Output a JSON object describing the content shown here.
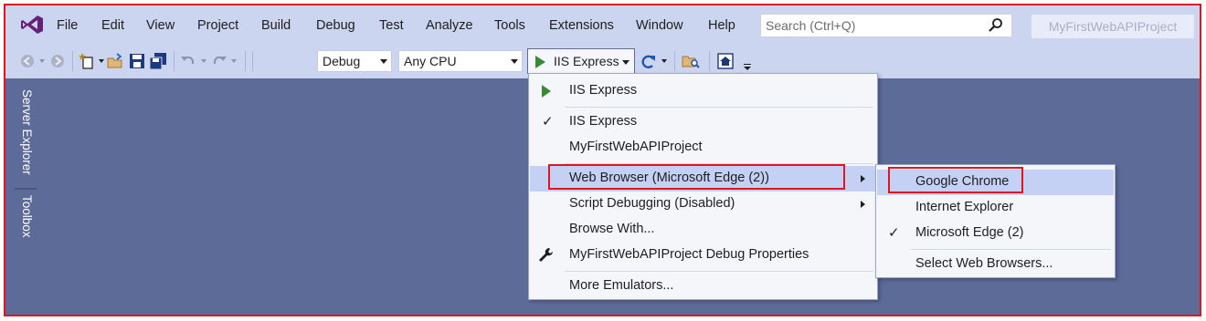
{
  "menubar": {
    "items": [
      "File",
      "Edit",
      "View",
      "Project",
      "Build",
      "Debug",
      "Test",
      "Analyze",
      "Tools",
      "Extensions",
      "Window",
      "Help"
    ],
    "search_placeholder": "Search (Ctrl+Q)",
    "project_name": "MyFirstWebAPIProject"
  },
  "toolbar": {
    "configuration": "Debug",
    "platform": "Any CPU",
    "run_target": "IIS Express",
    "icons": [
      "back-icon",
      "forward-icon",
      "new-project-icon",
      "open-folder-icon",
      "save-icon",
      "save-all-icon",
      "undo-icon",
      "redo-icon",
      "refresh-icon",
      "find-in-files-icon",
      "home-icon"
    ]
  },
  "side_tabs": {
    "server_explorer": "Server Explorer",
    "toolbox": "Toolbox"
  },
  "run_menu": {
    "items": [
      {
        "label": "IIS Express",
        "icon": "play-icon"
      },
      {
        "label": "IIS Express",
        "checked": true
      },
      {
        "label": "MyFirstWebAPIProject"
      },
      {
        "label": "Web Browser (Microsoft Edge (2))",
        "submenu": true,
        "highlighted": true
      },
      {
        "label": "Script Debugging (Disabled)",
        "submenu": true
      },
      {
        "label": "Browse With..."
      },
      {
        "label": "MyFirstWebAPIProject Debug Properties",
        "icon": "wrench-icon"
      },
      {
        "label": "More Emulators..."
      }
    ]
  },
  "browser_submenu": {
    "items": [
      {
        "label": "Google Chrome",
        "highlighted": true
      },
      {
        "label": "Internet Explorer"
      },
      {
        "label": "Microsoft Edge (2)",
        "checked": true
      },
      {
        "label": "Select Web Browsers..."
      }
    ]
  },
  "colors": {
    "chrome_bg": "#ccd5f0",
    "workspace_bg": "#5d6b99",
    "highlight": "#c5d1f4",
    "annotation_red": "#e0161f",
    "run_green": "#388a34"
  }
}
